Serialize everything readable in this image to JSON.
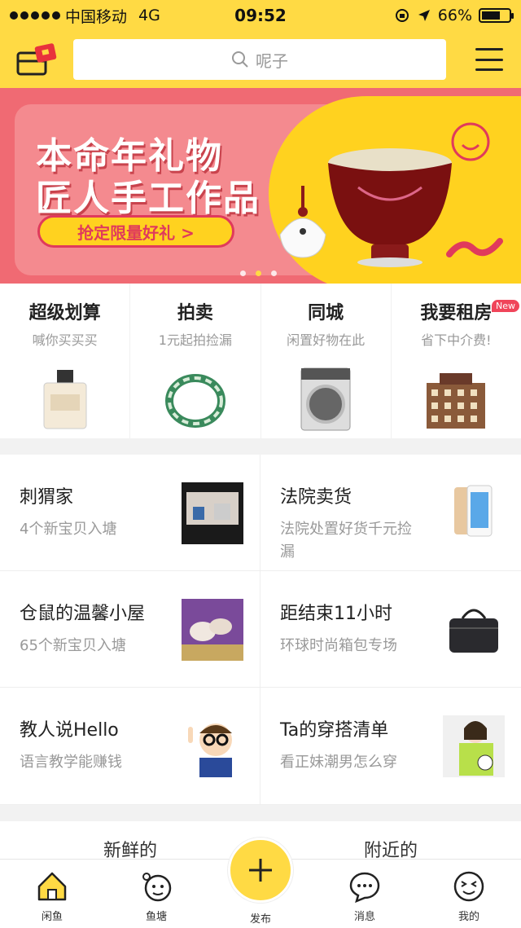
{
  "status_bar": {
    "carrier": "中国移动",
    "network": "4G",
    "time": "09:52",
    "battery": "66%"
  },
  "header": {
    "search_placeholder": "呢子"
  },
  "banner": {
    "title_line1": "本命年礼物",
    "title_line2": "匠人手工作品",
    "button_label": "抢定限量好礼 >",
    "dots": 3,
    "active_dot": 1
  },
  "features": [
    {
      "title": "超级划算",
      "subtitle": "喊你买买买",
      "icon": "perfume-icon"
    },
    {
      "title": "拍卖",
      "subtitle": "1元起拍捡漏",
      "icon": "jade-bracelet-icon"
    },
    {
      "title": "同城",
      "subtitle": "闲置好物在此",
      "icon": "washing-machine-icon"
    },
    {
      "title": "我要租房",
      "subtitle": "省下中介费!",
      "icon": "building-icon",
      "badge": "New"
    }
  ],
  "grid": [
    {
      "title": "刺猬家",
      "subtitle": "4个新宝贝入塘",
      "icon": "shop-photo-icon"
    },
    {
      "title": "法院卖货",
      "subtitle": "法院处置好货千元捡漏",
      "icon": "phone-icon"
    },
    {
      "title": "仓鼠的温馨小屋",
      "subtitle": "65个新宝贝入塘",
      "icon": "hamsters-icon"
    },
    {
      "title": "距结束11小时",
      "subtitle": "环球时尚箱包专场",
      "icon": "handbag-icon"
    },
    {
      "title": "教人说Hello",
      "subtitle": "语言教学能赚钱",
      "icon": "kid-glasses-icon"
    },
    {
      "title": "Ta的穿搭清单",
      "subtitle": "看正妹潮男怎么穿",
      "icon": "girl-photo-icon"
    }
  ],
  "tabs": [
    "新鲜的",
    "附近的"
  ],
  "tabbar": [
    {
      "label": "闲鱼",
      "icon": "home-icon"
    },
    {
      "label": "鱼塘",
      "icon": "pond-icon"
    },
    {
      "label": "发布",
      "icon": "plus-icon"
    },
    {
      "label": "消息",
      "icon": "message-icon"
    },
    {
      "label": "我的",
      "icon": "profile-icon"
    }
  ],
  "colors": {
    "brand_yellow": "#ffda44",
    "banner_pink": "#f06a73",
    "badge_red": "#f0455a"
  }
}
